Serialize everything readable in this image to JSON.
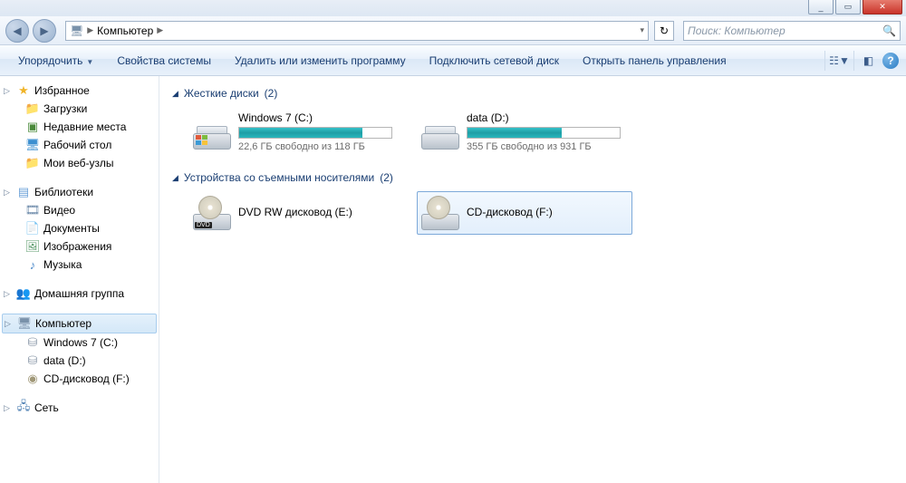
{
  "titlebar": {
    "min": "_",
    "max": "▭",
    "close": "✕"
  },
  "nav": {
    "back": "◀",
    "fwd": "▶",
    "crumb_root": "Компьютер",
    "refresh": "↻",
    "search_placeholder": "Поиск: Компьютер"
  },
  "toolbar": {
    "organize": "Упорядочить",
    "sysprops": "Свойства системы",
    "uninstall": "Удалить или изменить программу",
    "netdrive": "Подключить сетевой диск",
    "ctrlpanel": "Открыть панель управления",
    "help": "?"
  },
  "sidebar": {
    "favorites": {
      "label": "Избранное",
      "items": [
        {
          "label": "Загрузки"
        },
        {
          "label": "Недавние места"
        },
        {
          "label": "Рабочий стол"
        },
        {
          "label": "Мои веб-узлы"
        }
      ]
    },
    "libraries": {
      "label": "Библиотеки",
      "items": [
        {
          "label": "Видео"
        },
        {
          "label": "Документы"
        },
        {
          "label": "Изображения"
        },
        {
          "label": "Музыка"
        }
      ]
    },
    "homegroup": {
      "label": "Домашняя группа"
    },
    "computer": {
      "label": "Компьютер",
      "items": [
        {
          "label": "Windows 7 (C:)"
        },
        {
          "label": "data (D:)"
        },
        {
          "label": "CD-дисковод (F:)"
        }
      ]
    },
    "network": {
      "label": "Сеть"
    }
  },
  "content": {
    "hdd_group": {
      "label": "Жесткие диски",
      "count": "(2)"
    },
    "rem_group": {
      "label": "Устройства со съемными носителями",
      "count": "(2)"
    },
    "drives": [
      {
        "name": "Windows 7 (C:)",
        "stats": "22,6 ГБ свободно из 118 ГБ",
        "fill_pct": 81
      },
      {
        "name": "data (D:)",
        "stats": "355 ГБ свободно из 931 ГБ",
        "fill_pct": 62
      }
    ],
    "removable": [
      {
        "name": "DVD RW дисковод (E:)",
        "badge": "DVD"
      },
      {
        "name": "CD-дисковод (F:)",
        "badge": ""
      }
    ]
  }
}
